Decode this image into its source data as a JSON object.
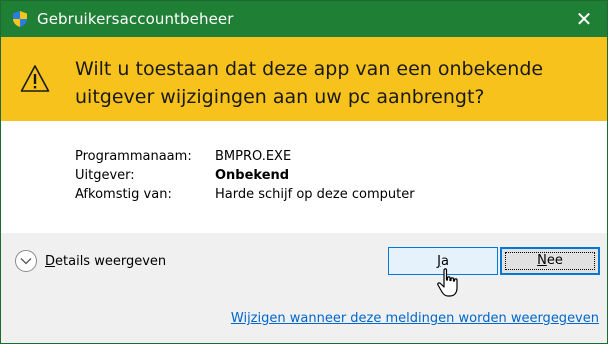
{
  "window": {
    "title": "Gebruikersaccountbeheer",
    "close_glyph": "✕"
  },
  "banner": {
    "question": "Wilt u toestaan dat deze app van een onbekende uitgever wijzigingen aan uw pc aanbrengt?",
    "icon": "warning-icon"
  },
  "info": {
    "program_label": "Programmanaam:",
    "program_value": "BMPRO.EXE",
    "publisher_label": "Uitgever:",
    "publisher_value": "Onbekend",
    "origin_label": "Afkomstig van:",
    "origin_value": "Harde schijf op deze computer"
  },
  "footer": {
    "details_label": "Details weergeven",
    "details_underline": "D",
    "details_rest": "etails weergeven",
    "yes_label": "Ja",
    "yes_underline": "J",
    "yes_rest": "a",
    "no_label": "Nee",
    "no_underline": "N",
    "no_rest": "ee",
    "change_link": "Wijzigen wanneer deze meldingen worden weergegeven"
  },
  "colors": {
    "titlebar": "#1f7f34",
    "banner": "#f7c21c",
    "accent": "#0078d7",
    "link": "#0066cc"
  }
}
